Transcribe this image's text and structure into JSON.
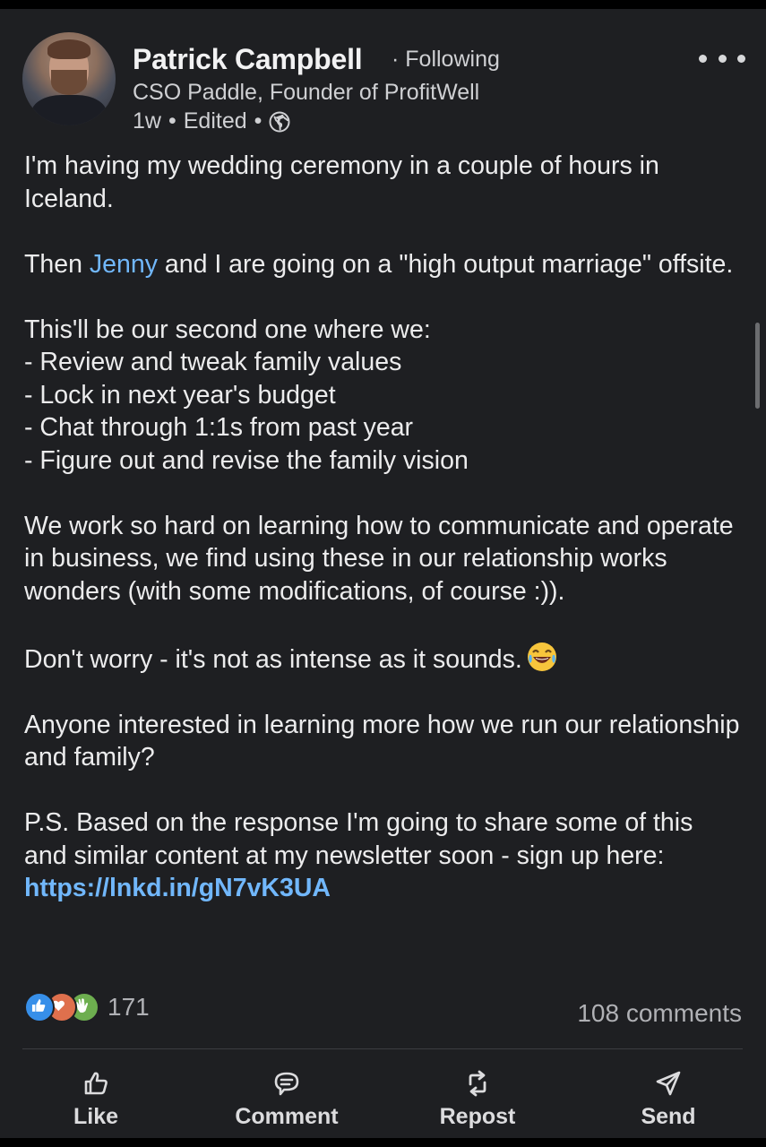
{
  "post": {
    "author": {
      "name": "Patrick Campbell",
      "follow_status": "· Following",
      "headline": "CSO Paddle, Founder of ProfitWell",
      "time": "1w",
      "edited": "Edited",
      "separator": "•",
      "visibility_icon": "globe-icon"
    },
    "body": {
      "p1": "I'm having my wedding ceremony in a couple of hours in Iceland.",
      "p2_before": "Then ",
      "p2_mention": "Jenny",
      "p2_after": " and I are going on a \"high output marriage\" offsite.",
      "p3_intro": "This'll be our second one where we:",
      "p3_items": [
        "- Review and tweak family values",
        "- Lock in next year's budget",
        "- Chat through 1:1s from past year",
        "- Figure out and revise the family vision"
      ],
      "p4": "We work so hard on learning how to communicate and operate in business, we find using these in our relationship works wonders (with some modifications, of course :)).",
      "p5": "Don't worry - it's not as intense as it sounds.",
      "p5_emoji": "laughing-emoji",
      "p6": "Anyone interested in learning more how we run our relationship and family?",
      "p7": "P.S. Based on the response I'm going to share some of this and similar content at my newsletter soon - sign up here: ",
      "p7_link": "https://lnkd.in/gN7vK3UA"
    },
    "stats": {
      "reaction_icons": [
        "like-reaction-icon",
        "love-reaction-icon",
        "celebrate-reaction-icon"
      ],
      "reactions_count": "171",
      "comments": "108 comments"
    },
    "actions": [
      {
        "label": "Like",
        "icon": "thumbs-up-icon"
      },
      {
        "label": "Comment",
        "icon": "comment-icon"
      },
      {
        "label": "Repost",
        "icon": "repost-icon"
      },
      {
        "label": "Send",
        "icon": "send-icon"
      }
    ]
  },
  "colors": {
    "background": "#1e1f22",
    "link": "#71b7fb",
    "text": "#ececed",
    "muted": "#b0b1b5"
  }
}
